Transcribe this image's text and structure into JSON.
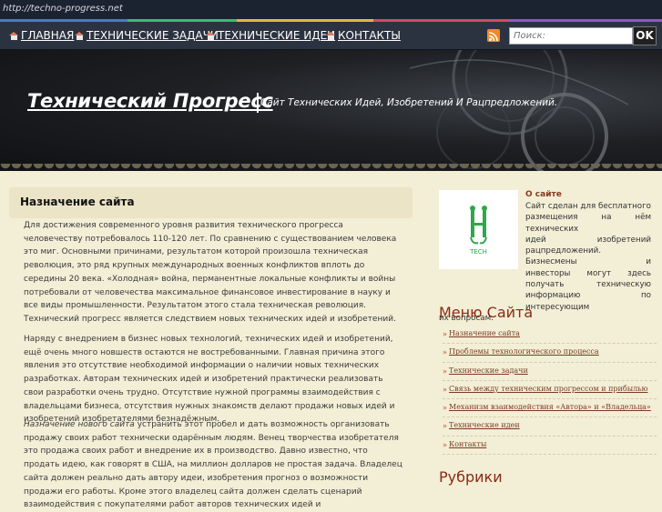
{
  "browser": {
    "url": "http://techno-progress.net"
  },
  "nav": {
    "items": [
      {
        "label": "ГЛАВНАЯ"
      },
      {
        "label": "ТЕХНИЧЕСКИЕ ЗАДАЧИ"
      },
      {
        "label": "ТЕХНИЧЕСКИЕ ИДЕИ"
      },
      {
        "label": "КОНТАКТЫ"
      }
    ],
    "search_placeholder": "Поиск:",
    "search_button": "OK"
  },
  "header": {
    "title": "Технический Прогресс",
    "slogan": "Сайт Технических Идей, Изобретений И Рацпредложений."
  },
  "content": {
    "title": "Назначение сайта",
    "p1": "Для достижения современного уровня развития технического прогресса человечеству потребовалось 110-120 лет. По сравнению с существованием человека это миг. Основными причинами, результатом которой произошла техническая революция, это ряд крупных международных военных конфликтов вплоть до середины 20 века. «Холодная» война, перманентные локальные конфликты и войны потребовали от человечества максимальное финансовое инвестирование в науку и все виды промышленности. Результатом этого стала техническая революция. Технический прогресс является следствием новых технических идей и изобретений.",
    "p2": "Наряду с внедрением в бизнес новых технологий, технических идей и изобретений, ещё очень много новшеств остаются не востребованными. Главная причина этого явления это отсутствие необходимой информации о наличии новых технических разработках. Авторам технических идей и изобретений практически реализовать свои разработки очень трудно. Отсутствие нужной программы взаимодействия с владельцами бизнеса, отсутствия нужных знакомств делают продажи новых идей и изобретений изобретателями безнадёжным.",
    "p3_lead": "Назначение нового сайта",
    "p3": " устранить этот пробел и дать возможность организовать продажу своих работ технически одарённым людям. Венец творчества изобретателя это продажа своих работ и внедрение их в производство. Давно известно, что продать идею, как говорят в США, на миллион долларов не простая задача. Владелец сайта должен реально дать автору идеи, изобретения прогноз о возможности продажи его работы. Кроме этого владелец сайта должен сделать сценарий взаимодействия с покупателями работ авторов технических идей и"
  },
  "sidebar": {
    "about_title": "О сайте",
    "about_lines": [
      "Сайт сделан для бесплатного",
      "размещения на нём технических",
      "идей изобретений",
      "рацпредложений. Бизнесмены и",
      "инвесторы могут здесь",
      "получать техническую",
      "информацию по интересующим"
    ],
    "about_tail": "их вопросам.",
    "logo_text": "TECH",
    "menu_title": "Меню Сайта",
    "menu_items": [
      "Назначение сайта",
      "Проблемы технологического процесса",
      "Технические задачи",
      "Связь между техническим прогрессом и прибылью",
      "Механизм взаимодействия «Автора» и «Владельца»",
      "Технические идеи",
      "Контакты"
    ],
    "rubrics_title": "Рубрики"
  },
  "colors": {
    "accent": "#8a2a15",
    "nav_bg": "#2c3340",
    "page_bg": "#f3eed6",
    "logo_green": "#2ea84a"
  }
}
